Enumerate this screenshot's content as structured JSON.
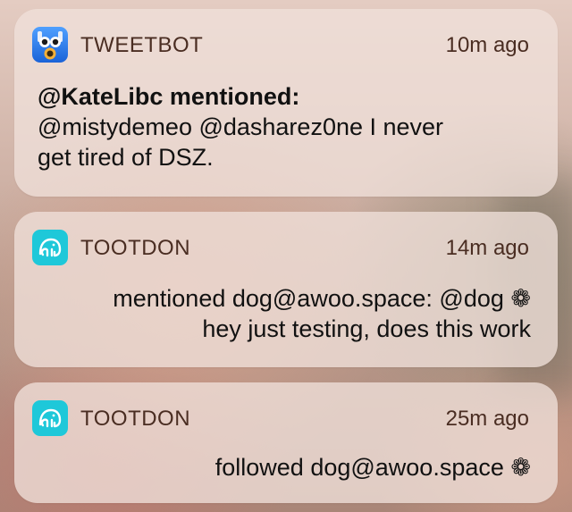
{
  "notifications": [
    {
      "app": "TWEETBOT",
      "icon": "tweetbot-app-icon",
      "time": "10m ago",
      "title": "@KateLibc mentioned:",
      "body_lines": [
        "@mistydemeo @dasharez0ne I never",
        "get tired of DSZ."
      ]
    },
    {
      "app": "TOOTDON",
      "icon": "tootdon-app-icon",
      "time": "14m ago",
      "body_lines": [
        "mentioned dog@awoo.space: @dog ❁",
        "hey just testing, does this work"
      ]
    },
    {
      "app": "TOOTDON",
      "icon": "tootdon-app-icon",
      "time": "25m ago",
      "body_lines": [
        "followed dog@awoo.space ❁"
      ]
    }
  ],
  "colors": {
    "tweetbot_icon": "#2d7ff2",
    "tootdon_icon": "#1ec8d9",
    "app_name_text": "#4a2d22",
    "card_background": "#f0e0da"
  }
}
